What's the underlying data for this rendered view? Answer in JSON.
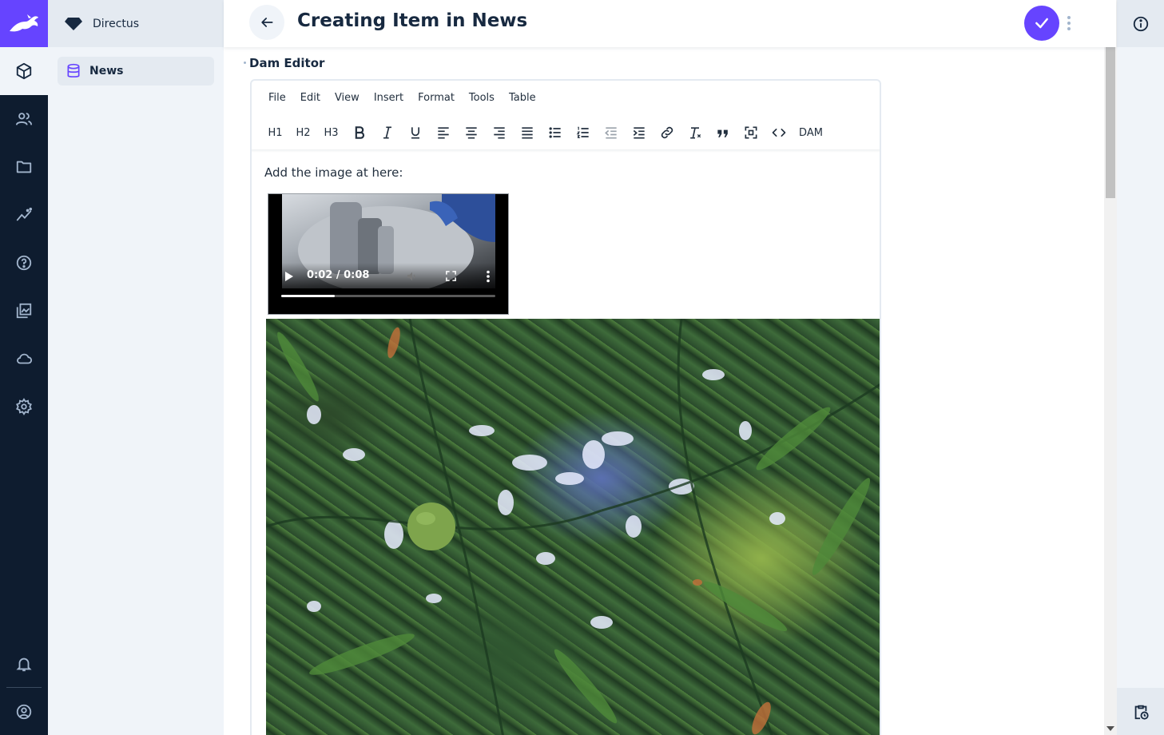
{
  "project": {
    "name": "Directus"
  },
  "modules": [
    {
      "name": "content",
      "active": true
    },
    {
      "name": "users"
    },
    {
      "name": "files"
    },
    {
      "name": "insights"
    },
    {
      "name": "help"
    },
    {
      "name": "dam"
    },
    {
      "name": "cloud"
    },
    {
      "name": "settings"
    },
    {
      "name": "notifications"
    },
    {
      "name": "account"
    }
  ],
  "navigation": {
    "items": [
      {
        "label": "News",
        "active": true
      }
    ]
  },
  "header": {
    "title": "Creating Item in News"
  },
  "field": {
    "label": "Dam Editor"
  },
  "editor": {
    "menu": [
      "File",
      "Edit",
      "View",
      "Insert",
      "Format",
      "Tools",
      "Table"
    ],
    "toolbar": {
      "h1": "H1",
      "h2": "H2",
      "h3": "H3",
      "dam": "DAM"
    },
    "content_text": "Add the image at here:"
  },
  "video": {
    "time": "0:02 / 0:08",
    "progress": 0.25
  },
  "colors": {
    "accent": "#6644ff",
    "module_bar": "#0e1c2f",
    "nav_bg": "#f0f4f9"
  }
}
